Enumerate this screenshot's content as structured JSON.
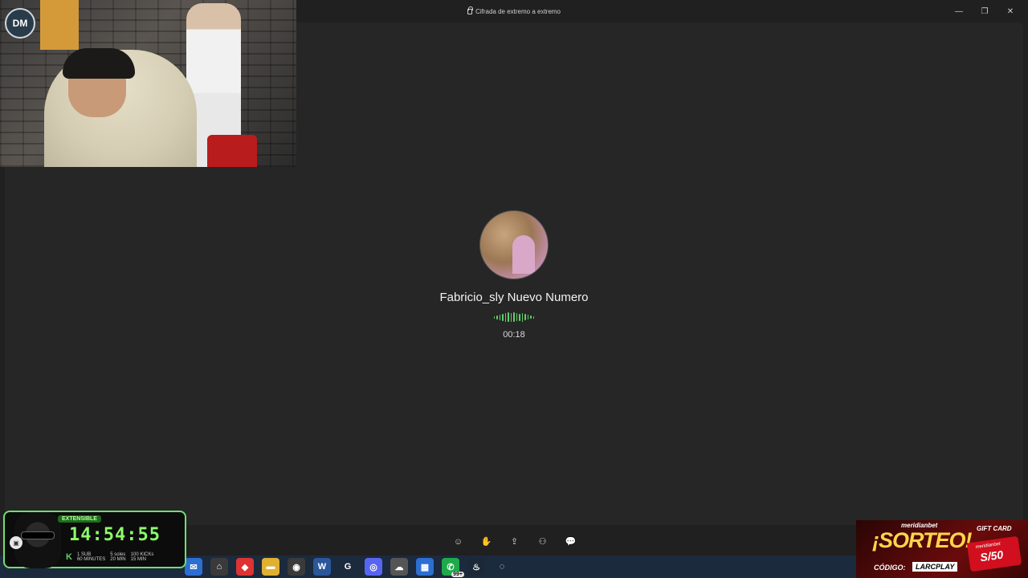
{
  "titlebar": {
    "encryption_text": "Cifrada de extremo a extremo"
  },
  "window_controls": {
    "minimize": "—",
    "restore": "❐",
    "close": "✕"
  },
  "call": {
    "contact_name": "Fabricio_sly Nuevo Numero",
    "duration": "00:18",
    "wave_color": "#5fcf6a"
  },
  "webcam": {
    "logo_text": "DM"
  },
  "call_controls": [
    {
      "name": "emoji-reaction-icon",
      "glyph": "☺"
    },
    {
      "name": "raise-hand-icon",
      "glyph": "✋"
    },
    {
      "name": "share-screen-icon",
      "glyph": "⇪"
    },
    {
      "name": "add-participant-icon",
      "glyph": "⚇"
    },
    {
      "name": "chat-icon",
      "glyph": "💬"
    }
  ],
  "stream_overlay": {
    "extensible_label": "EXTENSIBLE",
    "timer": "14:54:55",
    "rules": [
      {
        "amount": "1 SUB",
        "value": "60 MINUTES"
      },
      {
        "amount": "5 soles",
        "value": "20 MIN"
      },
      {
        "amount": "100 KICKs",
        "value": "15 MIN"
      }
    ]
  },
  "promo": {
    "brand": "meridianbet",
    "headline": "¡SORTEO!",
    "code_label": "CÓDIGO:",
    "code_value": "LARCPLAY",
    "gift_label": "GIFT CARD",
    "card_brand": "meridianbet",
    "card_value": "S/50"
  },
  "taskbar": {
    "badge_count": "99+"
  }
}
